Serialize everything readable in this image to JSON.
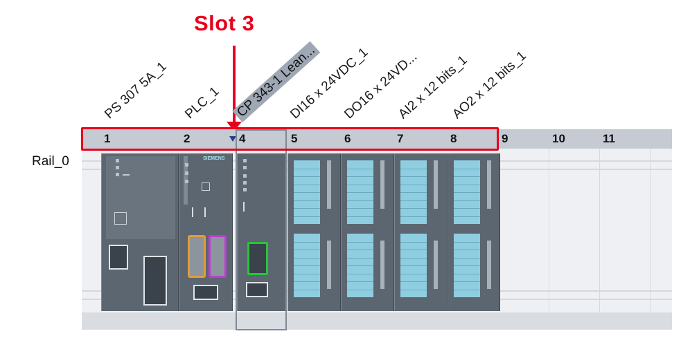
{
  "annotation": {
    "title": "Slot 3",
    "color": "#e8001c"
  },
  "rail": {
    "label": "Rail_0"
  },
  "slots": [
    "1",
    "2",
    "4",
    "5",
    "6",
    "7",
    "8",
    "9",
    "10",
    "11"
  ],
  "modules": [
    {
      "label": "PS 307 5A_1"
    },
    {
      "label": "PLC_1"
    },
    {
      "label": "CP 343-1 Lean..."
    },
    {
      "label": "DI16 x 24VDC_1"
    },
    {
      "label": "DO16 x 24VD..."
    },
    {
      "label": "AI2 x 12 bits_1"
    },
    {
      "label": "AO2 x 12 bits_1"
    }
  ],
  "plc_brand": "SIEMENS",
  "colors": {
    "selected_label_bg": "#9ea7b3",
    "module_body": "#5b6670",
    "io_strip": "#8fcde0",
    "port_orange": "#e59a3a",
    "port_purple": "#c03ad6",
    "port_green": "#29c43a"
  }
}
